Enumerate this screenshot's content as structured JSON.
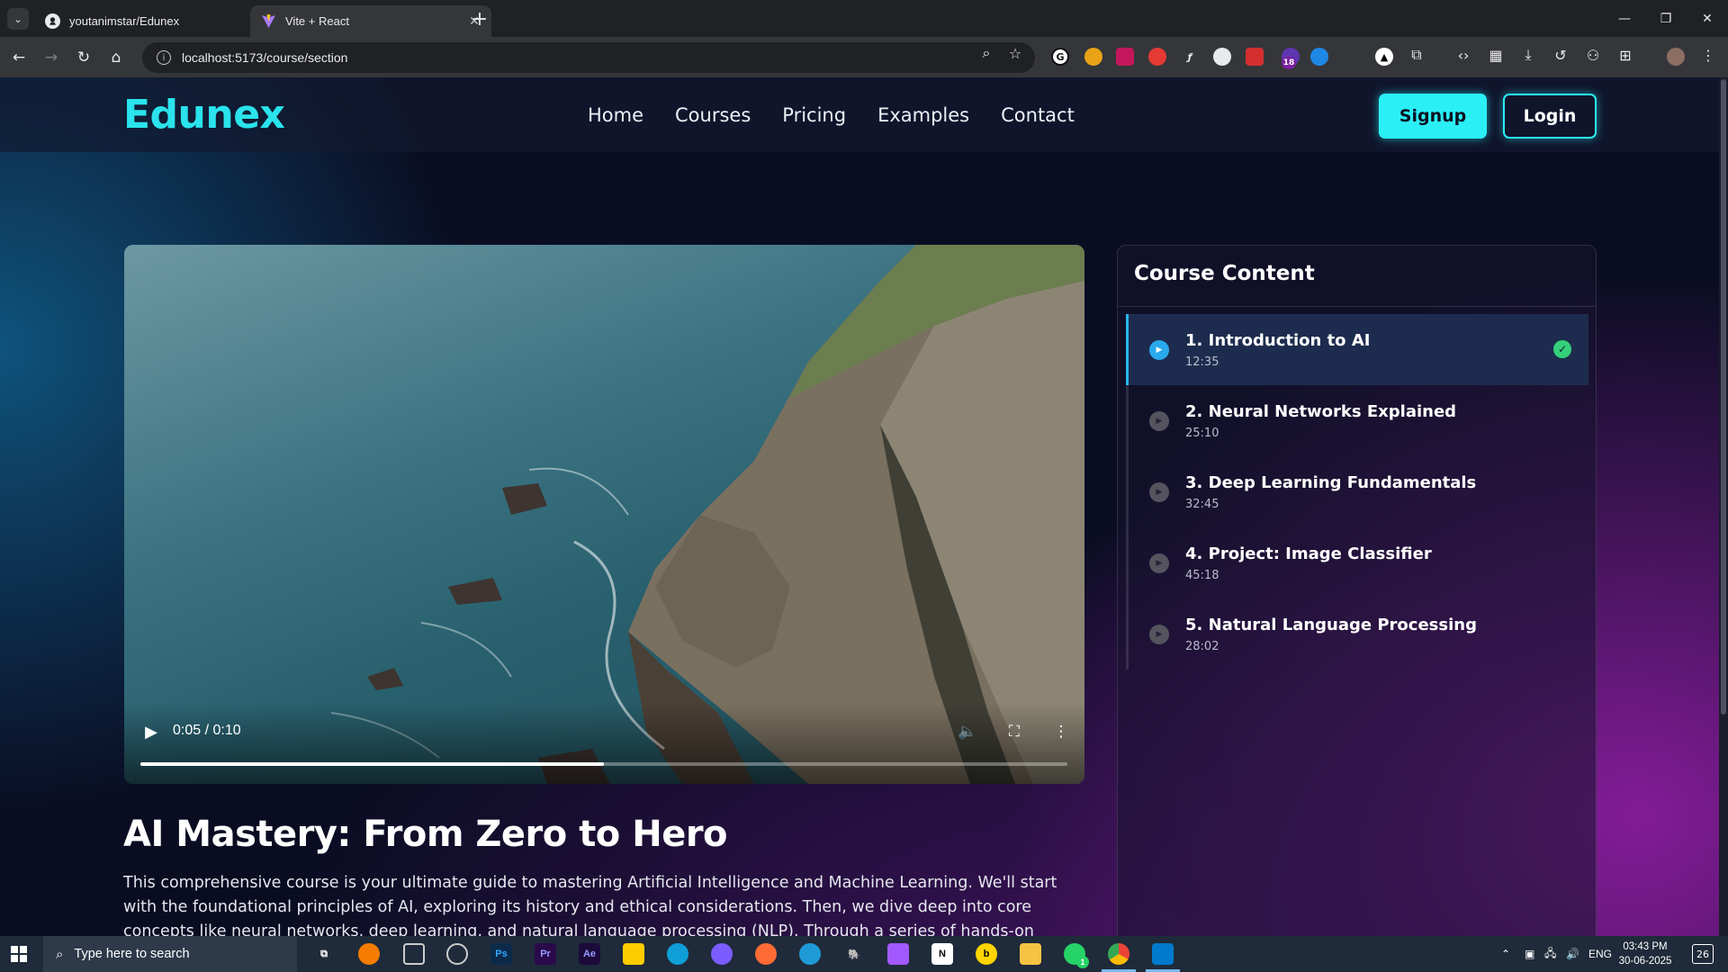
{
  "browser": {
    "tabs": [
      {
        "title": "youtanimstar/Edunex",
        "icon": "github-icon"
      },
      {
        "title": "Vite + React",
        "icon": "vite-icon"
      }
    ],
    "url": "localhost:5173/course/section"
  },
  "site": {
    "logo": "Edunex",
    "nav": [
      "Home",
      "Courses",
      "Pricing",
      "Examples",
      "Contact"
    ],
    "signup_label": "Signup",
    "login_label": "Login",
    "accent_color": "#2af0f6"
  },
  "video": {
    "time": "0:05 / 0:10",
    "progress": 0.5
  },
  "course": {
    "title": "AI Mastery: From Zero to Hero",
    "description": "This comprehensive course is your ultimate guide to mastering Artificial Intelligence and Machine Learning. We'll start with the foundational principles of AI, exploring its history and ethical considerations. Then, we dive deep into core concepts like neural networks, deep learning, and natural language processing (NLP). Through a series of hands-on"
  },
  "sidebar": {
    "heading": "Course Content",
    "lessons": [
      {
        "title": "1. Introduction to AI",
        "duration": "12:35",
        "active": true,
        "completed": true
      },
      {
        "title": "2. Neural Networks Explained",
        "duration": "25:10",
        "active": false,
        "completed": false
      },
      {
        "title": "3. Deep Learning Fundamentals",
        "duration": "32:45",
        "active": false,
        "completed": false
      },
      {
        "title": "4. Project: Image Classifier",
        "duration": "45:18",
        "active": false,
        "completed": false
      },
      {
        "title": "5. Natural Language Processing",
        "duration": "28:02",
        "active": false,
        "completed": false
      }
    ]
  },
  "taskbar": {
    "search_placeholder": "Type here to search",
    "language": "ENG",
    "time": "03:43 PM",
    "date": "30-06-2025",
    "notifications": "26",
    "extension_badge": "18",
    "whatsapp_badge": "1"
  }
}
